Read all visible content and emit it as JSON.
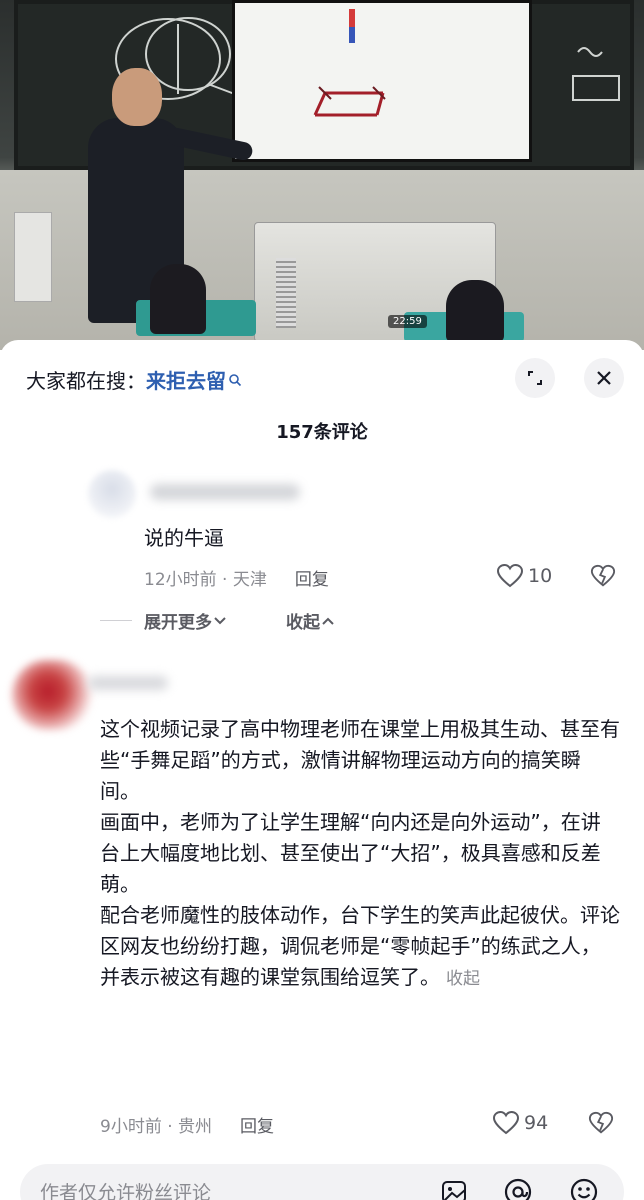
{
  "video": {
    "timestamp": "22:59"
  },
  "search": {
    "prefix": "大家都在搜：",
    "term": "来拒去留"
  },
  "comments": {
    "count_label": "157条评论",
    "reply": {
      "text": "说的牛逼",
      "meta": "12小时前 · 天津",
      "reply_label": "回复",
      "likes": "10"
    },
    "thread": {
      "expand_label": "展开更多",
      "collapse_label": "收起"
    },
    "main": {
      "paragraphs": [
        "这个视频记录了高中物理老师在课堂上用极其生动、甚至有些“手舞足蹈”的方式，激情讲解物理运动方向的搞笑瞬间。",
        "画面中，老师为了让学生理解“向内还是向外运动”，在讲台上大幅度地比划、甚至使出了“大招”，极具喜感和反差萌。",
        "配合老师魔性的肢体动作，台下学生的笑声此起彼伏。评论区网友也纷纷打趣，调侃老师是“零帧起手”的练武之人，并表示被这有趣的课堂氛围给逗笑了。"
      ],
      "inline_collapse": "收起",
      "meta": "9小时前 · 贵州",
      "reply_label": "回复",
      "likes": "94"
    }
  },
  "input": {
    "placeholder": "作者仅允许粉丝评论"
  },
  "colors": {
    "search_term": "#2e5fb0",
    "muted": "#8a8b91",
    "sheet_bg": "#ffffff"
  }
}
